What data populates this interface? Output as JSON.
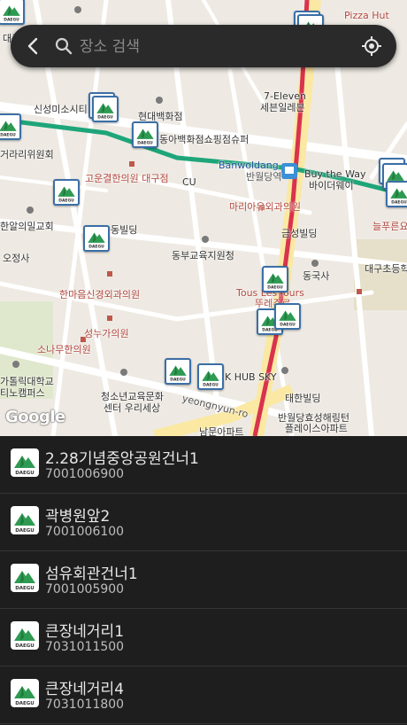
{
  "search": {
    "placeholder": "장소 검색"
  },
  "map": {
    "attribution": "Google",
    "labels": [
      "Pizza Hut",
      "대구",
      "7-Eleven",
      "세븐일레븐",
      "현대백화점",
      "동아백화점쇼핑점슈퍼",
      "신성미소시티",
      "거라리위원회",
      "Banwoldang",
      "반월당역",
      "Buy the Way",
      "바이더웨이",
      "고운결한의원 대구점",
      "CU",
      "마리아유외과의원",
      "한알의밀교회",
      "동빌딩",
      "금성빌딩",
      "늘푸른요",
      "대구초등학",
      "동부교육지원청",
      "오정사",
      "동국사",
      "Tous Les Jours",
      "뚜레쥬르",
      "한마음신경외과의원",
      "성누가의원",
      "소나무한의원",
      "가톨릭대학교",
      "티노캠퍼스",
      "청소년교육문화",
      "센터 우리세상",
      "K HUB SKY",
      "yeongnyun-ro",
      "태한빌딩",
      "반월당효성해링턴",
      "플레이스아파트",
      "남문아파트"
    ],
    "marker_icon": "daegu-bus-stop-icon",
    "marker_text": "DAEGU"
  },
  "stops": [
    {
      "name": "2.28기념중앙공원건너1",
      "code": "7001006900"
    },
    {
      "name": "곽병원앞2",
      "code": "7001006100"
    },
    {
      "name": "섬유회관건너1",
      "code": "7001005900"
    },
    {
      "name": "큰장네거리1",
      "code": "7031011500"
    },
    {
      "name": "큰장네거리4",
      "code": "7031011800"
    }
  ],
  "colors": {
    "subway_green": "#1ea579",
    "subway_red": "#d9334d",
    "marker_border": "#3b6fa6",
    "logo_green": "#2e9a52"
  }
}
